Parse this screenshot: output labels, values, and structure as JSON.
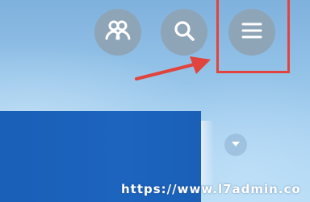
{
  "toolbar": {
    "people_icon": "people-icon",
    "search_icon": "search-icon",
    "menu_icon": "hamburger-menu-icon"
  },
  "annotation": {
    "highlight_color": "#e0443c",
    "arrow_color": "#e0443c"
  },
  "watermark": {
    "text": "https://www.l7admin.co"
  },
  "colors": {
    "button_bg": "#8ea4b7",
    "panel_bg": "#1c64be"
  }
}
